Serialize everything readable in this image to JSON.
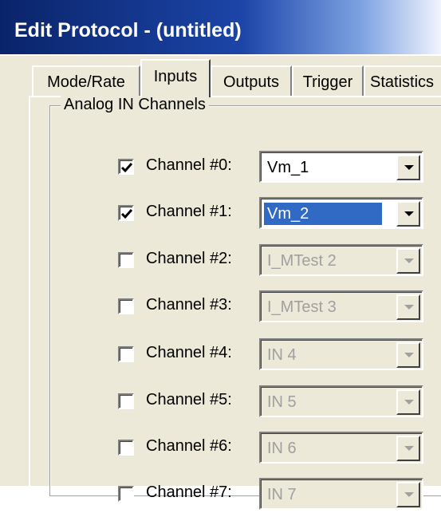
{
  "window": {
    "title": "Edit Protocol - (untitled)",
    "colors": {
      "titlebar": "#0a246a",
      "face": "#ece9d8",
      "selection": "#316ac5",
      "disabled_text": "#a0a0a0"
    }
  },
  "tabs": [
    {
      "label": "Mode/Rate",
      "active": false
    },
    {
      "label": "Inputs",
      "active": true
    },
    {
      "label": "Outputs",
      "active": false
    },
    {
      "label": "Trigger",
      "active": false
    },
    {
      "label": "Statistics",
      "active": false
    }
  ],
  "group": {
    "title": "Analog IN Channels",
    "channels": [
      {
        "label": "Channel #0:",
        "checked": true,
        "value": "Vm_1",
        "enabled": true,
        "selected": false
      },
      {
        "label": "Channel #1:",
        "checked": true,
        "value": "Vm_2",
        "enabled": true,
        "selected": true
      },
      {
        "label": "Channel #2:",
        "checked": false,
        "value": "I_MTest 2",
        "enabled": false,
        "selected": false
      },
      {
        "label": "Channel #3:",
        "checked": false,
        "value": "I_MTest 3",
        "enabled": false,
        "selected": false
      },
      {
        "label": "Channel #4:",
        "checked": false,
        "value": "IN 4",
        "enabled": false,
        "selected": false
      },
      {
        "label": "Channel #5:",
        "checked": false,
        "value": "IN 5",
        "enabled": false,
        "selected": false
      },
      {
        "label": "Channel #6:",
        "checked": false,
        "value": "IN 6",
        "enabled": false,
        "selected": false
      },
      {
        "label": "Channel #7:",
        "checked": false,
        "value": "IN 7",
        "enabled": false,
        "selected": false
      }
    ]
  },
  "icons": {
    "checkbox_mark": "checkmark-icon",
    "dropdown": "chevron-down-icon"
  }
}
